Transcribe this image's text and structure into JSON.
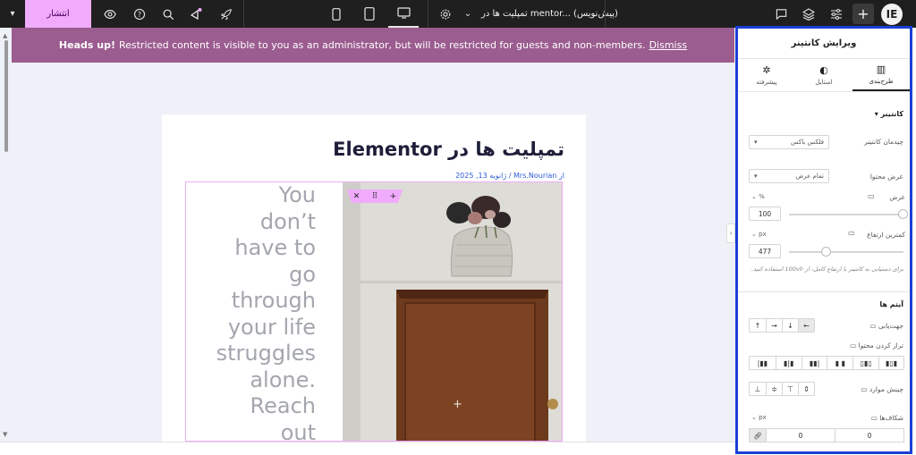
{
  "topbar": {
    "publish_label": "انتشار",
    "doc_title": "تمپلیت ها در mentor... (پیش‌نویس)",
    "icons": [
      "chevron-down-icon",
      "eye-icon",
      "help-icon",
      "search-icon",
      "notifications-icon",
      "rocket-icon",
      "mobile-icon",
      "tablet-icon",
      "desktop-icon",
      "settings-icon",
      "chat-icon",
      "layers-icon",
      "sliders-icon",
      "plus-icon",
      "elementor-logo"
    ]
  },
  "banner": {
    "strong": "Heads up!",
    "text": "Restricted content is visible to you as an administrator, but will be restricted for guests and non-members.",
    "dismiss": "Dismiss"
  },
  "page": {
    "title": "تمپلیت ها در Elementor",
    "byline": "از Mrs.Nourian / ژانویه 13, 2025",
    "quote_lines": [
      "You",
      "don’t",
      "have to",
      "go",
      "through",
      "your life",
      "struggles",
      "alone.",
      "Reach",
      "out"
    ]
  },
  "panel": {
    "title": "ویرایش کانتینر",
    "tabs": [
      {
        "label": "طرح‌بندی",
        "icon": "layout-icon"
      },
      {
        "label": "استایل",
        "icon": "style-icon"
      },
      {
        "label": "پیشرفته",
        "icon": "gear-icon"
      }
    ],
    "section_container": "کانتینر",
    "layout_label": "چیدمان کانتینر",
    "layout_value": "فلکس باکس",
    "content_width_label": "عرض محتوا",
    "content_width_value": "تمام عرض",
    "width_label": "عرض",
    "width_unit": "%",
    "width_value": "100",
    "min_height_label": "کمترین ارتفاع",
    "min_height_unit": "px",
    "min_height_value": "477",
    "note": "برای دستیابی به کانتینر با ارتفاع کامل، از 100vh استفاده کنید.",
    "section_items": "آیتم ها",
    "direction_label": "جهت‌یابی",
    "justify_label": "تراز کردن محتوا",
    "align_label": "چینش موارد",
    "gaps_label": "شکاف‌ها",
    "gaps_unit": "px",
    "gap_col": "0",
    "gap_row": "0"
  }
}
